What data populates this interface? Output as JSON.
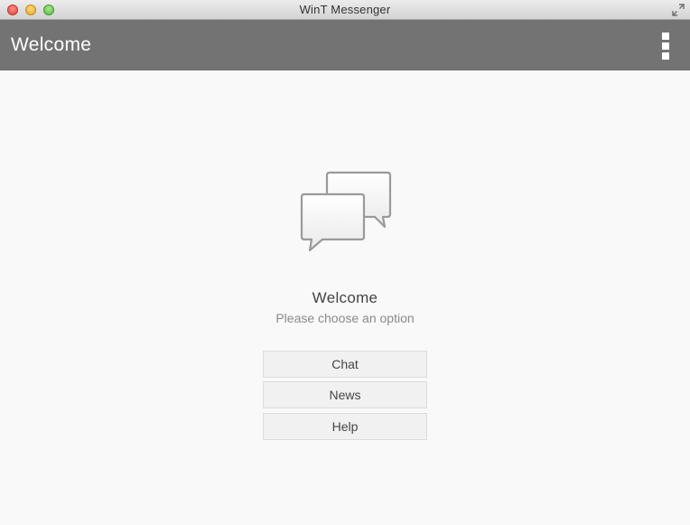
{
  "window": {
    "title": "WinT Messenger",
    "controls": [
      "close",
      "minimize",
      "zoom"
    ],
    "fullscreen_icon": "fullscreen-arrows-icon"
  },
  "toolbar": {
    "title": "Welcome",
    "menu_icon": "overflow-menu-icon",
    "background_color": "#737373"
  },
  "main": {
    "illustration_icon": "chat-bubbles-icon",
    "heading": "Welcome",
    "subheading": "Please choose an option",
    "buttons": [
      {
        "label": "Chat"
      },
      {
        "label": "News"
      },
      {
        "label": "Help"
      }
    ]
  }
}
